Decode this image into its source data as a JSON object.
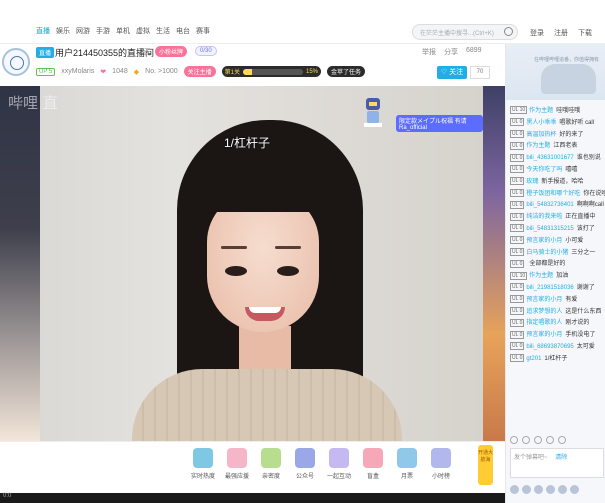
{
  "nav": {
    "items": [
      "直播",
      "娱乐",
      "网游",
      "手游",
      "单机",
      "虚拟",
      "生活",
      "电台",
      "赛事"
    ],
    "search_placeholder": "在茫茫主播中搜寻...(Ctrl+K)",
    "right": [
      "登录",
      "注册",
      "下载"
    ]
  },
  "room": {
    "live_tag": "直播",
    "title": "用户214450355的直播间",
    "sub": "3天",
    "pill_pink": "小粉丝牌",
    "pill_blue": "0/30",
    "actions": [
      "举报",
      "分享",
      "6899"
    ],
    "level": "UP 5",
    "anchor": "xxyMolaris",
    "stats_heart": "1048",
    "stats_no": "No. >1000",
    "badge_red": "关注主播",
    "rank_label": "第1关",
    "rank_percent": "15%",
    "rank_fill_fraction": 0.15,
    "rank_suffix": "金苹了任务",
    "follow": "关注",
    "follow_count": "70"
  },
  "video": {
    "watermark": "哔哩 直",
    "caption": "1/杠杆子",
    "badge": "限定款メイプル祝福 有请Ra_official"
  },
  "gifts": {
    "items": [
      "实时热度",
      "最强应援",
      "亲密度",
      "公众号",
      "一起互动",
      "盲盒",
      "月票",
      "小时榜"
    ],
    "right_label": "开通大航海"
  },
  "status": {
    "text": "0:0"
  },
  "chat": {
    "banner": "在哔哩哔哩追番，你值得拥有",
    "messages": [
      {
        "lv": "UL 10",
        "user": "作为主题",
        "text": "哇哦哇哦"
      },
      {
        "lv": "UL 0",
        "user": "黑人小乖乖",
        "text": "唱歌好听 call"
      },
      {
        "lv": "UL 0",
        "user": "高温加热杯",
        "text": "好的来了"
      },
      {
        "lv": "UL 0",
        "user": "作为主题",
        "text": "江西老表"
      },
      {
        "lv": "UL 0",
        "user": "bili_43631001677",
        "text": "谁也别说"
      },
      {
        "lv": "UL 0",
        "user": "今天你吃了吗",
        "text": "嘻嘻"
      },
      {
        "lv": "UL 0",
        "user": "玫瑰",
        "text": "新手报道，哈哈"
      },
      {
        "lv": "UL 0",
        "user": "橙子饭团和哪个好吃",
        "text": "你在说啥"
      },
      {
        "lv": "UL 0",
        "user": "bili_54832736401",
        "text": "啊啊啊call"
      },
      {
        "lv": "UL 0",
        "user": "纯洁的我来啦",
        "text": "正在直播中"
      },
      {
        "lv": "UL 0",
        "user": "bili_54831315215",
        "text": "该打了"
      },
      {
        "lv": "UL 0",
        "user": "预言家的小月",
        "text": "小可爱"
      },
      {
        "lv": "UL 0",
        "user": "白马骑士的小猪",
        "text": "三分之一"
      },
      {
        "lv": "UL 0",
        "user": "",
        "text": "全部都是好的"
      },
      {
        "lv": "UL 10",
        "user": "作为主题",
        "text": "加油"
      },
      {
        "lv": "UL 0",
        "user": "bili_21981518036",
        "text": "谢谢了"
      },
      {
        "lv": "UL 0",
        "user": "预言家的小月",
        "text": "有爱"
      },
      {
        "lv": "UL 0",
        "user": "追求梦想的人",
        "text": "这是什么东西"
      },
      {
        "lv": "UL 0",
        "user": "指定唱歌的人",
        "text": "刚才说的"
      },
      {
        "lv": "UL 0",
        "user": "预言家的小月",
        "text": "手机没电了"
      },
      {
        "lv": "UL 0",
        "user": "bili_68693870695",
        "text": "太可爱"
      },
      {
        "lv": "UL 0",
        "user": "gt201",
        "text": "1/杠杆子"
      }
    ],
    "input_placeholder": "发个弹幕吧~",
    "input_hint": "清除"
  }
}
